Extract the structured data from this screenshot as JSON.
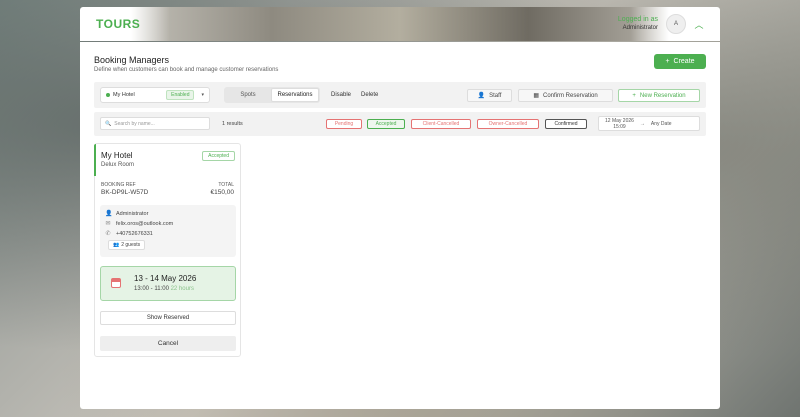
{
  "header": {
    "logo": "TOURS",
    "logged_in_label": "Logged in as",
    "user_name": "Administrator",
    "avatar_initial": "A"
  },
  "page": {
    "title": "Booking Managers",
    "subtitle": "Define when customers can book and manage customer reservations",
    "create_label": "Create"
  },
  "toolbar": {
    "hotel_name": "My Hotel",
    "hotel_status": "Enabled",
    "tabs": [
      "Spots",
      "Reservations"
    ],
    "active_tab": "Reservations",
    "disable_label": "Disable",
    "delete_label": "Delete",
    "staff_label": "Staff",
    "confirm_label": "Confirm Reservation",
    "new_reservation_label": "New Reservation"
  },
  "filters": {
    "search_placeholder": "Search by name...",
    "results_count": "1 results",
    "status_chips": [
      {
        "label": "Pending",
        "color": "#e57373"
      },
      {
        "label": "Accepted",
        "color": "#4caf50"
      },
      {
        "label": "Client-Cancelled",
        "color": "#e57373"
      },
      {
        "label": "Owner-Cancelled",
        "color": "#e57373"
      },
      {
        "label": "Confirmed",
        "color": "#555555"
      }
    ],
    "date_from_day": "12 May 2026",
    "date_from_time": "15:09",
    "date_arrow": "→",
    "date_to": "Any Date"
  },
  "reservation": {
    "hotel": "My Hotel",
    "room": "Delux Room",
    "status": "Accepted",
    "booking_ref_label": "BOOKING REF",
    "booking_ref": "BK-DP9L-W57D",
    "total_label": "TOTAL",
    "total": "€150,00",
    "contact_name": "Administrator",
    "contact_email": "felix.oros@outlook.com",
    "contact_phone": "+40752676331",
    "guests": "2 guests",
    "date_range": "13 - 14 May 2026",
    "time_range": "13:00 - 11:00",
    "duration": "22 hours",
    "show_reserved_label": "Show Reserved",
    "cancel_label": "Cancel"
  },
  "colors": {
    "accent": "#4caf50",
    "danger": "#e57373"
  }
}
